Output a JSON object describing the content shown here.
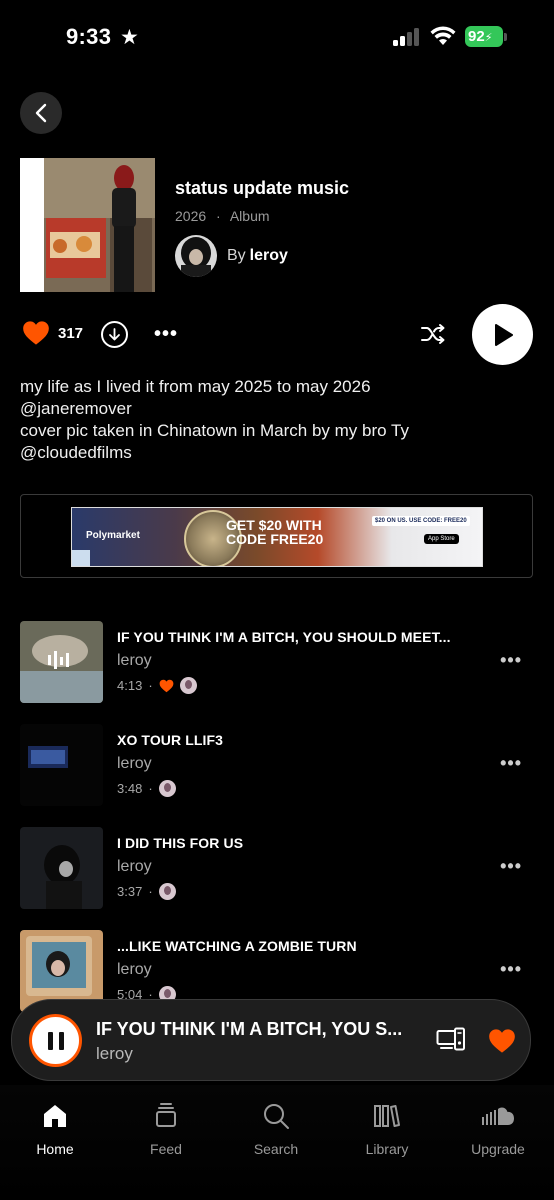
{
  "status_bar": {
    "time": "9:33",
    "battery": "92"
  },
  "album": {
    "title": "status update music",
    "year": "2026",
    "type": "Album",
    "by_prefix": "By",
    "artist": "leroy",
    "likes": "317"
  },
  "description": {
    "lines": [
      "my life as I lived it from may 2025 to may 2026",
      "@janeremover",
      "cover pic taken in Chinatown in March by my bro Ty",
      "@cloudedfilms"
    ]
  },
  "ad": {
    "brand": "Polymarket",
    "headline": "GET $20 WITH CODE FREE20",
    "cta": "$20 ON US. USE CODE: FREE20",
    "store": "App Store"
  },
  "tracks": [
    {
      "title": "IF YOU THINK I'M A BITCH, YOU SHOULD MEET...",
      "artist": "leroy",
      "duration": "4:13",
      "liked": true
    },
    {
      "title": "XO TOUR LLIF3",
      "artist": "leroy",
      "duration": "3:48",
      "liked": false
    },
    {
      "title": "I DID THIS FOR US",
      "artist": "leroy",
      "duration": "3:37",
      "liked": false
    },
    {
      "title": "...LIKE WATCHING A ZOMBIE TURN",
      "artist": "leroy",
      "duration": "5:04",
      "liked": false
    }
  ],
  "mini_player": {
    "title": "IF YOU THINK I'M A BITCH, YOU S...",
    "artist": "leroy"
  },
  "nav": {
    "items": [
      {
        "label": "Home",
        "icon": "home-icon",
        "active": true
      },
      {
        "label": "Feed",
        "icon": "feed-icon",
        "active": false
      },
      {
        "label": "Search",
        "icon": "search-icon",
        "active": false
      },
      {
        "label": "Library",
        "icon": "library-icon",
        "active": false
      },
      {
        "label": "Upgrade",
        "icon": "soundcloud-icon",
        "active": false
      }
    ]
  },
  "colors": {
    "accent": "#ff5500",
    "background": "#000000",
    "battery": "#34c759"
  }
}
